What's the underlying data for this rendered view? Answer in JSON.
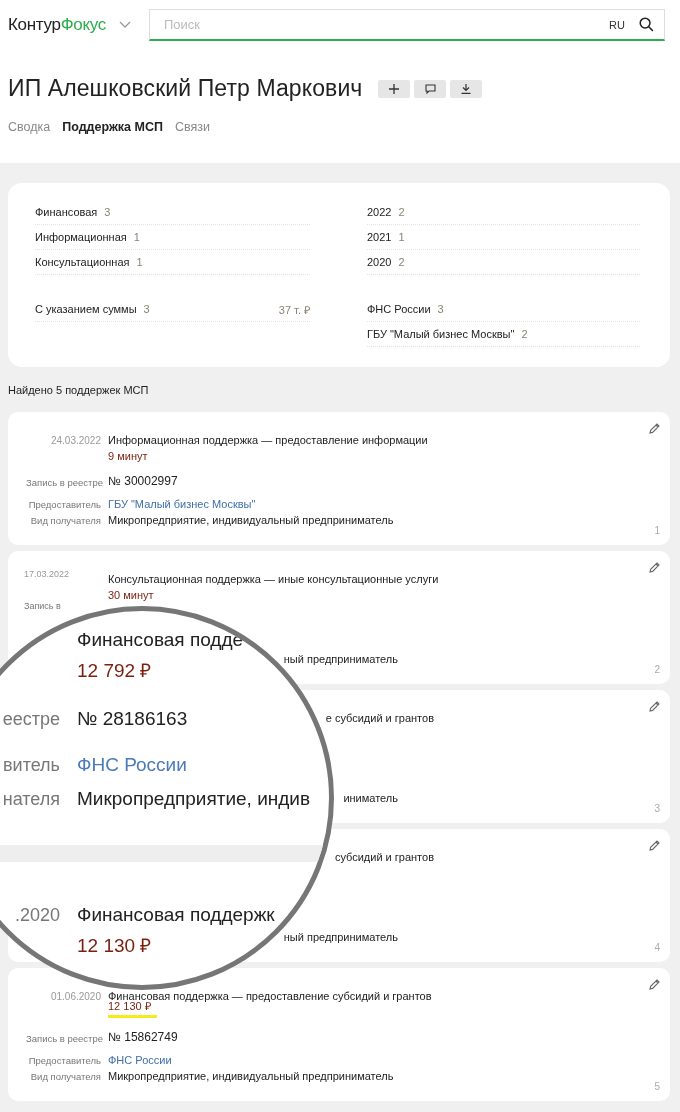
{
  "header": {
    "logo_main": "Контур",
    "logo_accent": "Фокус",
    "search": {
      "placeholder": "Поиск",
      "lang": "RU"
    }
  },
  "title": "ИП Алешковский Петр Маркович",
  "tabs": [
    {
      "label": "Сводка",
      "selected": false
    },
    {
      "label": "Поддержка МСП",
      "selected": true
    },
    {
      "label": "Связи",
      "selected": false
    }
  ],
  "summary": {
    "left_groups": [
      [
        {
          "label": "Финансовая",
          "count": "3"
        },
        {
          "label": "Информационная",
          "count": "1"
        },
        {
          "label": "Консультационная",
          "count": "1"
        }
      ],
      [
        {
          "label": "С указанием суммы",
          "count": "3",
          "amount": "37 т. ₽"
        }
      ]
    ],
    "right_groups": [
      [
        {
          "label": "2022",
          "count": "2"
        },
        {
          "label": "2021",
          "count": "1"
        },
        {
          "label": "2020",
          "count": "2"
        }
      ],
      [
        {
          "label": "ФНС России",
          "count": "3"
        },
        {
          "label": "ГБУ \"Малый бизнес Москвы\"",
          "count": "2"
        }
      ]
    ]
  },
  "found": "Найдено 5 поддержек МСП",
  "cards": [
    {
      "kind": "full",
      "number": "1",
      "lines": [
        {
          "kind": "title",
          "label": "24.03.2022",
          "value": "Информационная поддержка — предоставление информации"
        },
        {
          "kind": "duration",
          "value": "9 минут"
        },
        {
          "kind": "registry",
          "label": "Запись в реестре",
          "value": "№ 30002997"
        },
        {
          "kind": "link",
          "label": "Предоставитель",
          "value": "ГБУ \"Малый бизнес Москвы\""
        },
        {
          "kind": "text",
          "label": "Вид получателя",
          "value": "Микропредприятие, индивидуальный предприниматель"
        }
      ]
    },
    {
      "kind": "covered",
      "number": "2",
      "lines": [
        {
          "kind": "title",
          "label": "17.03.2022",
          "value": "Консультационная поддержка — иные консультационные услуги"
        },
        {
          "kind": "duration",
          "value": "30 минут"
        },
        {
          "kind": "registry",
          "label": "Запись в"
        },
        {
          "kind": "text",
          "value": "ный предприниматель"
        }
      ]
    },
    {
      "kind": "covered",
      "number": "3",
      "lines": [
        {
          "kind": "title",
          "value": "е субсидий и грантов"
        },
        {
          "kind": "text",
          "value": "иниматель"
        }
      ]
    },
    {
      "kind": "covered",
      "number": "4",
      "lines": [
        {
          "kind": "title",
          "value": "субсидий и грантов"
        },
        {
          "kind": "text",
          "value": "ный предприниматель"
        }
      ]
    },
    {
      "kind": "full",
      "number": "5",
      "lines": [
        {
          "kind": "title",
          "label": "01.06.2020",
          "value": "Финансовая поддержка — предоставление субсидий и грантов"
        },
        {
          "kind": "amount",
          "value": "12 130 ₽",
          "highlighted": true
        },
        {
          "kind": "registry",
          "label": "Запись в реестре",
          "value": "№ 15862749"
        },
        {
          "kind": "link",
          "label": "Предоставитель",
          "value": "ФНС России"
        },
        {
          "kind": "text",
          "label": "Вид получателя",
          "value": "Микропредприятие, индивидуальный предприниматель"
        }
      ]
    }
  ],
  "magnifier": {
    "rows": [
      {
        "kind": "title",
        "value": "Финансовая подде"
      },
      {
        "kind": "amount",
        "value": "12 792 ₽"
      },
      {
        "kind": "registry",
        "label": "еестре",
        "value": "№ 28186163"
      },
      {
        "kind": "link",
        "label": "витель",
        "value": "ФНС России"
      },
      {
        "kind": "text",
        "label": "нателя",
        "value": "Микропредприятие, индив"
      },
      {
        "kind": "gap"
      },
      {
        "kind": "title",
        "label": ".2020",
        "value": "Финансовая поддержк"
      },
      {
        "kind": "amount",
        "value": "12 130 ₽"
      }
    ]
  }
}
